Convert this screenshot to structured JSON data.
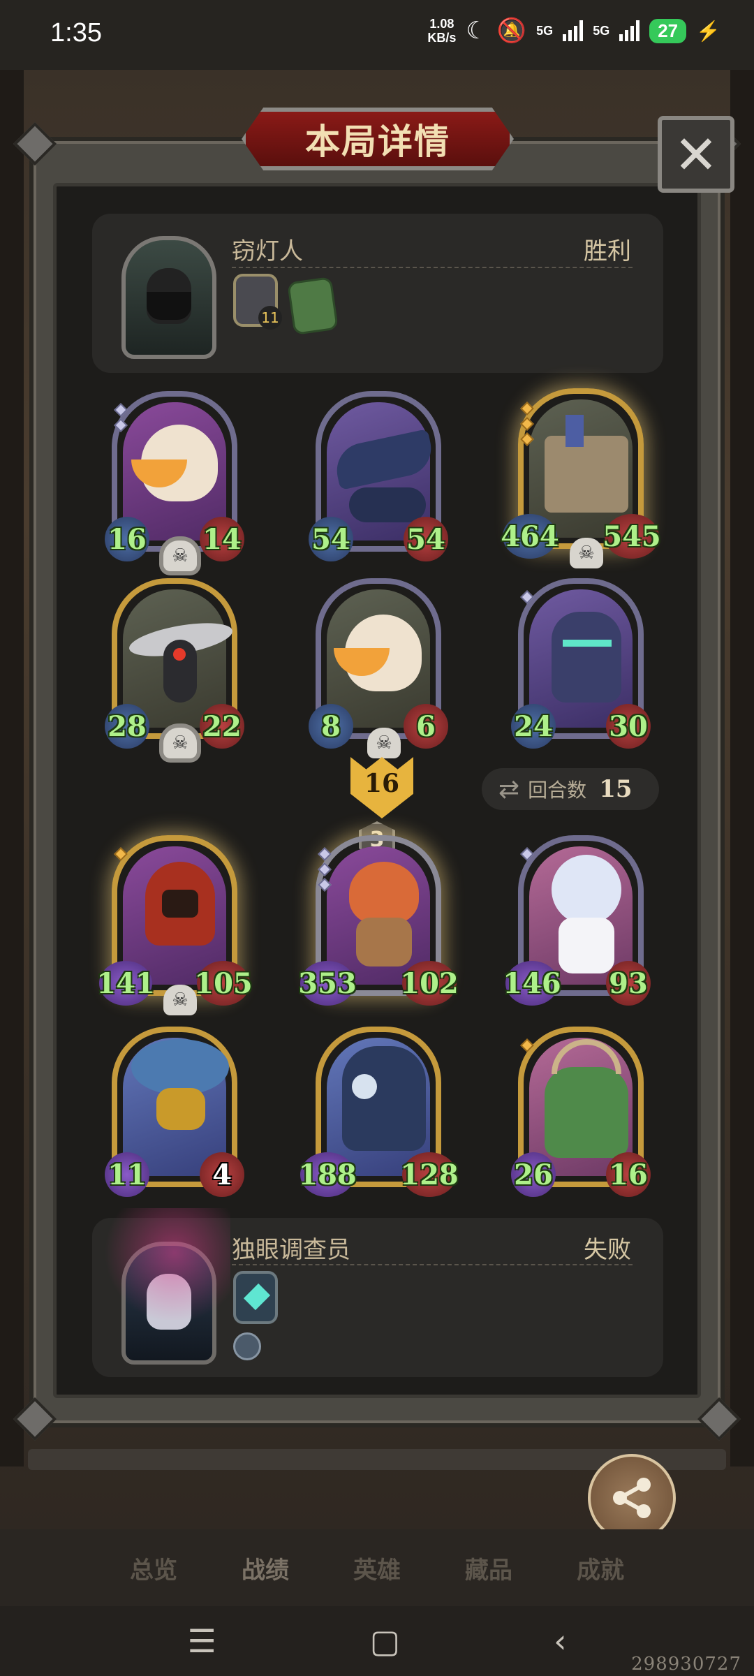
{
  "status": {
    "time": "1:35",
    "speed": "1.08",
    "speed_unit": "KB/s",
    "net1": "5G",
    "net2": "5G",
    "battery": "27"
  },
  "modal": {
    "title": "本局详情",
    "close_glyph": "✕"
  },
  "player1": {
    "name": "窃灯人",
    "result": "胜利",
    "item_badge": "11"
  },
  "player2": {
    "name": "独眼调查员",
    "result": "失败"
  },
  "board_top": [
    {
      "atk": "16",
      "hp": "14",
      "name": "pelican"
    },
    {
      "atk": "54",
      "hp": "54",
      "name": "shadow-dragon"
    },
    {
      "atk": "464",
      "hp": "545",
      "name": "fortress"
    },
    {
      "atk": "28",
      "hp": "22",
      "name": "mech-bird"
    },
    {
      "atk": "8",
      "hp": "6",
      "name": "pelican-small"
    },
    {
      "atk": "24",
      "hp": "30",
      "name": "ghost-skeleton"
    }
  ],
  "board_bottom": [
    {
      "atk": "141",
      "hp": "105",
      "name": "hooded-assassin"
    },
    {
      "atk": "353",
      "hp": "102",
      "name": "archer-boy"
    },
    {
      "atk": "146",
      "hp": "93",
      "name": "snow-girl"
    },
    {
      "atk": "11",
      "hp": "4",
      "name": "hydra"
    },
    {
      "atk": "188",
      "hp": "128",
      "name": "dragon-king"
    },
    {
      "atk": "26",
      "hp": "16",
      "name": "crocodile"
    }
  ],
  "turn": {
    "label": "回合数",
    "value": "15"
  },
  "level": {
    "value": "16",
    "tier": "3"
  },
  "share": {
    "label": "分享"
  },
  "nav": {
    "items": [
      "总览",
      "战绩",
      "英雄",
      "藏品",
      "成就"
    ],
    "active": "战绩"
  },
  "watermark": "298930727"
}
